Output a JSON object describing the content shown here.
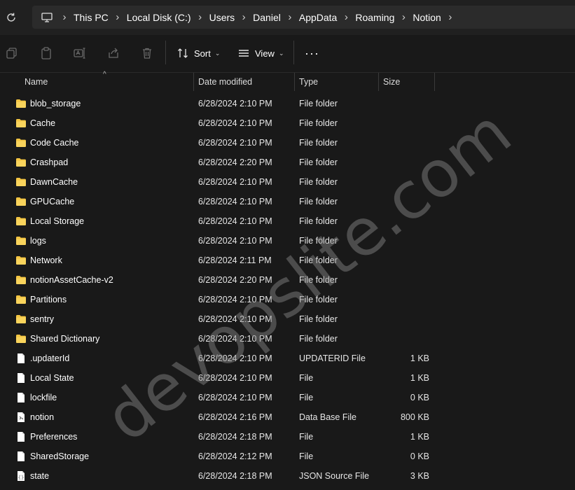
{
  "breadcrumb": [
    "This PC",
    "Local Disk (C:)",
    "Users",
    "Daniel",
    "AppData",
    "Roaming",
    "Notion"
  ],
  "toolbar": {
    "sort_label": "Sort",
    "view_label": "View",
    "more_label": "···"
  },
  "columns": {
    "name": "Name",
    "date": "Date modified",
    "type": "Type",
    "size": "Size"
  },
  "files": [
    {
      "name": "blob_storage",
      "date": "6/28/2024 2:10 PM",
      "type": "File folder",
      "size": "",
      "icon": "folder-icon"
    },
    {
      "name": "Cache",
      "date": "6/28/2024 2:10 PM",
      "type": "File folder",
      "size": "",
      "icon": "folder-icon"
    },
    {
      "name": "Code Cache",
      "date": "6/28/2024 2:10 PM",
      "type": "File folder",
      "size": "",
      "icon": "folder-icon"
    },
    {
      "name": "Crashpad",
      "date": "6/28/2024 2:20 PM",
      "type": "File folder",
      "size": "",
      "icon": "folder-icon"
    },
    {
      "name": "DawnCache",
      "date": "6/28/2024 2:10 PM",
      "type": "File folder",
      "size": "",
      "icon": "folder-icon"
    },
    {
      "name": "GPUCache",
      "date": "6/28/2024 2:10 PM",
      "type": "File folder",
      "size": "",
      "icon": "folder-icon"
    },
    {
      "name": "Local Storage",
      "date": "6/28/2024 2:10 PM",
      "type": "File folder",
      "size": "",
      "icon": "folder-icon"
    },
    {
      "name": "logs",
      "date": "6/28/2024 2:10 PM",
      "type": "File folder",
      "size": "",
      "icon": "folder-icon"
    },
    {
      "name": "Network",
      "date": "6/28/2024 2:11 PM",
      "type": "File folder",
      "size": "",
      "icon": "folder-icon"
    },
    {
      "name": "notionAssetCache-v2",
      "date": "6/28/2024 2:20 PM",
      "type": "File folder",
      "size": "",
      "icon": "folder-icon"
    },
    {
      "name": "Partitions",
      "date": "6/28/2024 2:10 PM",
      "type": "File folder",
      "size": "",
      "icon": "folder-icon"
    },
    {
      "name": "sentry",
      "date": "6/28/2024 2:10 PM",
      "type": "File folder",
      "size": "",
      "icon": "folder-icon"
    },
    {
      "name": "Shared Dictionary",
      "date": "6/28/2024 2:10 PM",
      "type": "File folder",
      "size": "",
      "icon": "folder-icon"
    },
    {
      "name": ".updaterId",
      "date": "6/28/2024 2:10 PM",
      "type": "UPDATERID File",
      "size": "1 KB",
      "icon": "file-icon"
    },
    {
      "name": "Local State",
      "date": "6/28/2024 2:10 PM",
      "type": "File",
      "size": "1 KB",
      "icon": "file-icon"
    },
    {
      "name": "lockfile",
      "date": "6/28/2024 2:10 PM",
      "type": "File",
      "size": "0 KB",
      "icon": "file-icon"
    },
    {
      "name": "notion",
      "date": "6/28/2024 2:16 PM",
      "type": "Data Base File",
      "size": "800 KB",
      "icon": "database-file-icon"
    },
    {
      "name": "Preferences",
      "date": "6/28/2024 2:18 PM",
      "type": "File",
      "size": "1 KB",
      "icon": "file-icon"
    },
    {
      "name": "SharedStorage",
      "date": "6/28/2024 2:12 PM",
      "type": "File",
      "size": "0 KB",
      "icon": "file-icon"
    },
    {
      "name": "state",
      "date": "6/28/2024 2:18 PM",
      "type": "JSON Source File",
      "size": "3 KB",
      "icon": "json-file-icon"
    }
  ],
  "watermark": "devopslite.com",
  "colors": {
    "folder": "#f4c542",
    "background": "#191919",
    "addressbar": "#2b2b2b"
  }
}
